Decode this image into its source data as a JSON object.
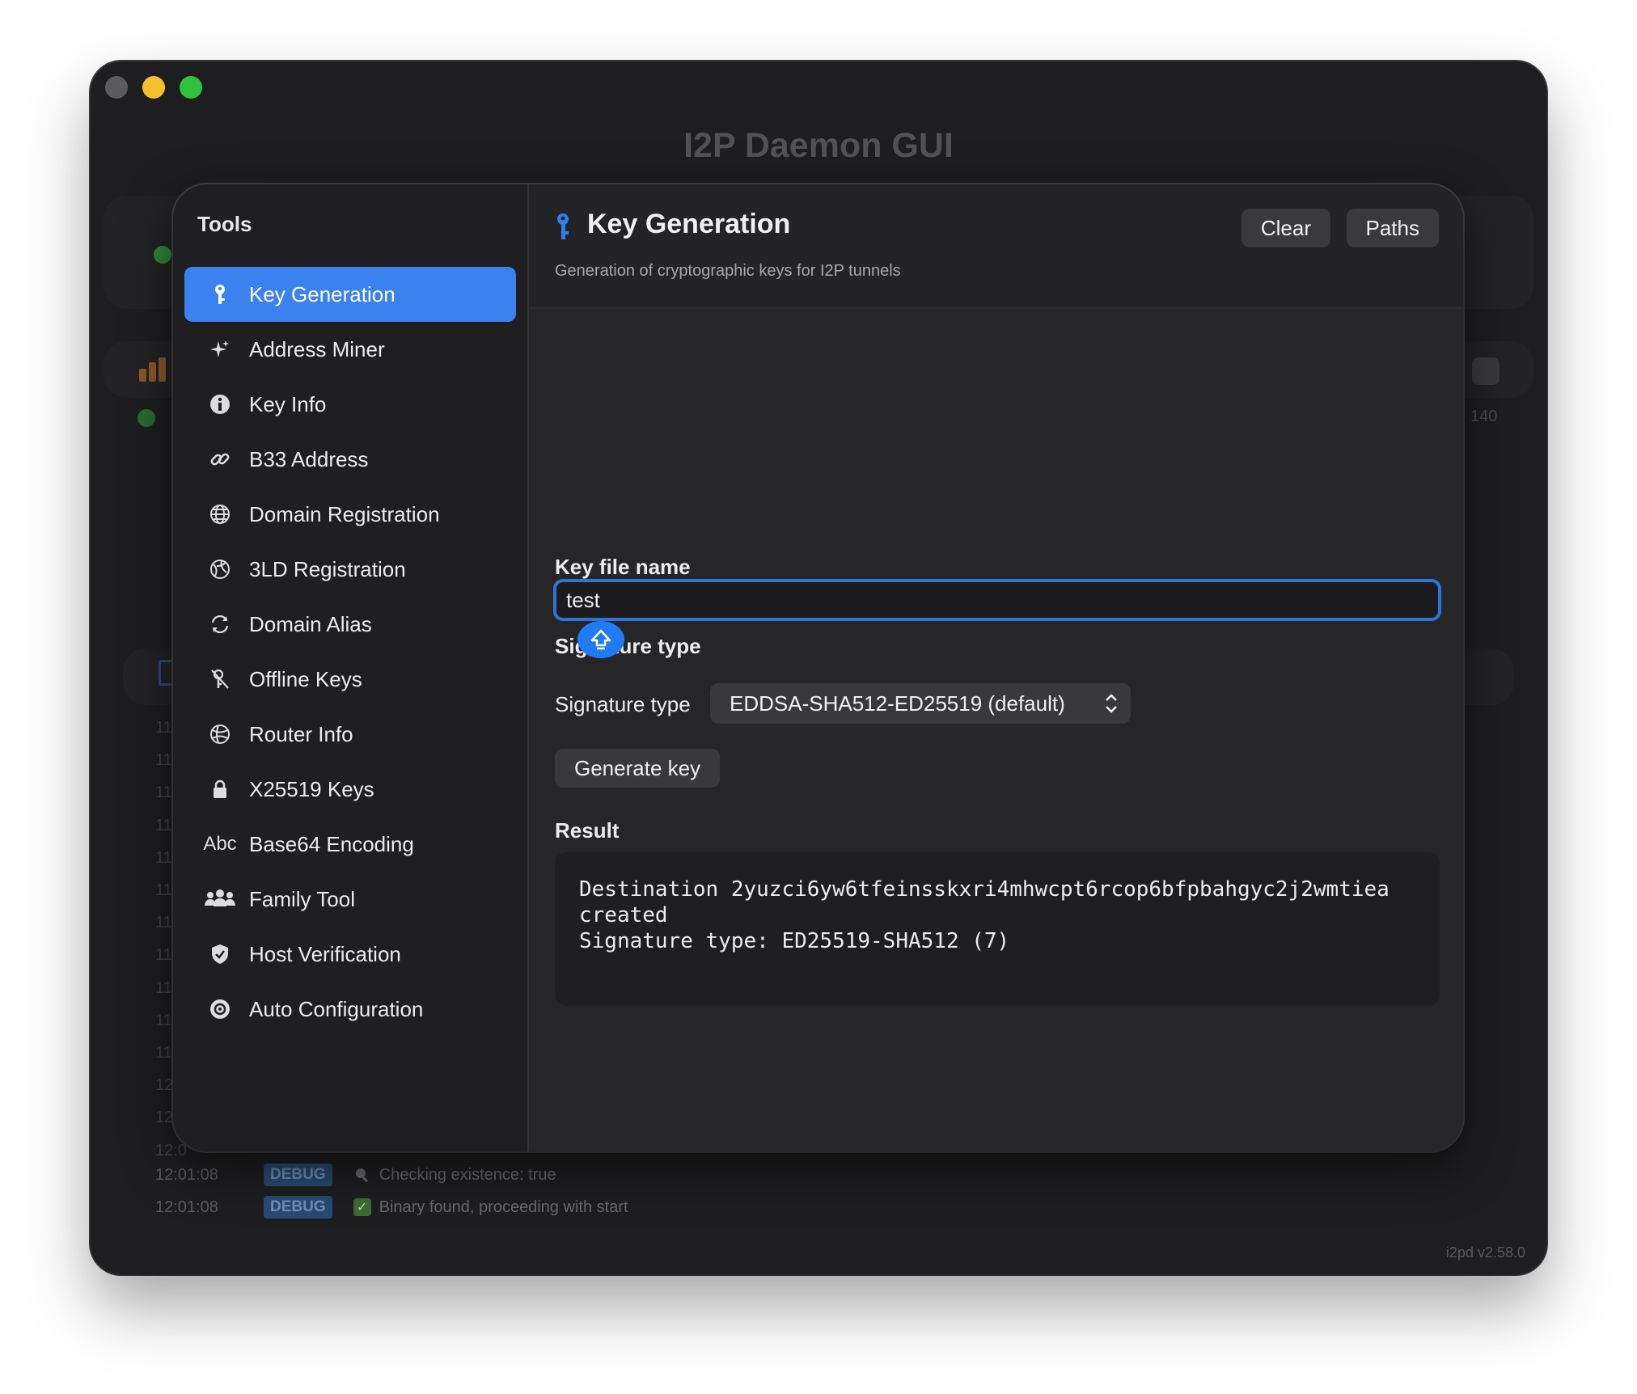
{
  "window": {
    "title": "I2P Daemon GUI",
    "version": "i2pd v2.58.0"
  },
  "background": {
    "peer_count": "140",
    "time_prefixes": [
      "11",
      "11",
      "11",
      "11",
      "11",
      "11",
      "11",
      "11",
      "11",
      "11",
      "11",
      "12",
      "12",
      "12:0"
    ],
    "log": [
      {
        "time": "12:01:08",
        "level": "DEBUG",
        "icon": "magnifier-icon",
        "message": "Checking existence:  true"
      },
      {
        "time": "12:01:08",
        "level": "DEBUG",
        "icon": "checkmark-icon",
        "message": "Binary found, proceeding with start"
      }
    ]
  },
  "sidebar": {
    "title": "Tools",
    "items": [
      {
        "label": "Key Generation",
        "icon": "key-icon",
        "active": true
      },
      {
        "label": "Address Miner",
        "icon": "sparkle-icon"
      },
      {
        "label": "Key Info",
        "icon": "info-icon"
      },
      {
        "label": "B33 Address",
        "icon": "link-icon"
      },
      {
        "label": "Domain Registration",
        "icon": "globe-icon"
      },
      {
        "label": "3LD Registration",
        "icon": "network-globe-icon"
      },
      {
        "label": "Domain Alias",
        "icon": "refresh-icon"
      },
      {
        "label": "Offline Keys",
        "icon": "key-slash-icon"
      },
      {
        "label": "Router Info",
        "icon": "globe-icon"
      },
      {
        "label": "X25519 Keys",
        "icon": "lock-icon"
      },
      {
        "label": "Base64 Encoding",
        "icon": "abc-icon",
        "icon_text": "Abc"
      },
      {
        "label": "Family Tool",
        "icon": "people-icon"
      },
      {
        "label": "Host Verification",
        "icon": "shield-check-icon"
      },
      {
        "label": "Auto Configuration",
        "icon": "gear-circle-icon"
      }
    ]
  },
  "header": {
    "title": "Key Generation",
    "subtitle": "Generation of cryptographic keys for I2P tunnels",
    "clear_label": "Clear",
    "paths_label": "Paths"
  },
  "form": {
    "key_file_label": "Key file name",
    "key_file_value": "test",
    "signature_section_label": "Signature type",
    "signature_row_label": "Signature type",
    "signature_selected": "EDDSA-SHA512-ED25519 (default)",
    "generate_label": "Generate key",
    "result_label": "Result",
    "result_lines": [
      "Destination 2yuzci6yw6tfeinsskxri4mhwcpt6rcop6bfpbahgyc2j2wmtiea",
      "created",
      "Signature type: ED25519-SHA512 (7)"
    ]
  },
  "colors": {
    "accent": "#3b82f0",
    "focus_ring": "#2d74d6",
    "debug_badge": "#2a4a73"
  }
}
